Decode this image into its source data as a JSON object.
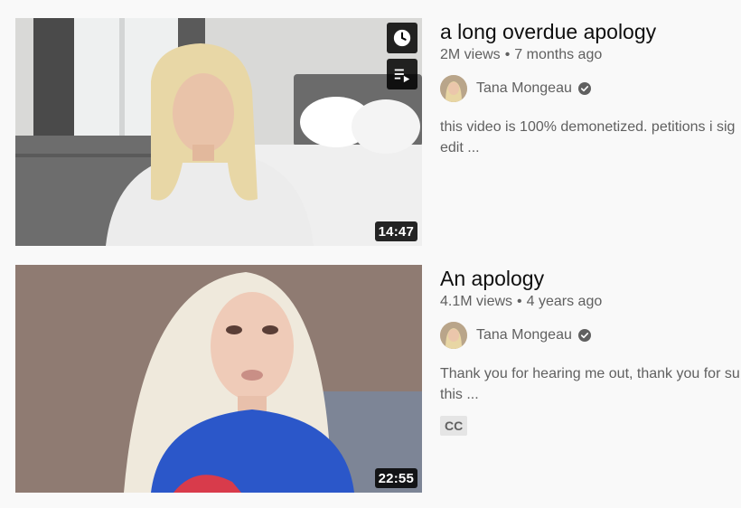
{
  "results": [
    {
      "title": "a long overdue apology",
      "views": "2M views",
      "age": "7 months ago",
      "channel": "Tana Mongeau",
      "description_line1": "this video is 100% demonetized. petitions i sig",
      "description_line2": "edit ...",
      "duration": "14:47",
      "hover_icons": [
        "clock-icon",
        "add-to-queue-icon"
      ]
    },
    {
      "title": "An apology",
      "views": "4.1M views",
      "age": "4 years ago",
      "channel": "Tana Mongeau",
      "description_line1": "Thank you for hearing me out, thank you for su",
      "description_line2": "this ...",
      "duration": "22:55",
      "badge": "CC"
    }
  ],
  "meta_separator": "•",
  "colors": {
    "background": "#f9f9f9",
    "title": "#0f0f0f",
    "secondary_text": "#606060",
    "overlay": "#000000",
    "badge_bg": "#e5e5e5"
  }
}
